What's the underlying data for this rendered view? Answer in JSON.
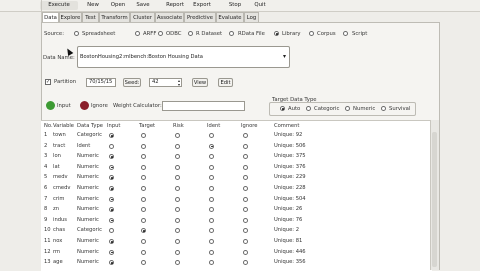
{
  "toolbar": {
    "items": [
      "Execute",
      "New",
      "Open",
      "Save",
      "Report",
      "Export",
      "Stop",
      "Quit"
    ]
  },
  "tabs": [
    "Data",
    "Explore",
    "Test",
    "Transform",
    "Cluster",
    "Associate",
    "Predictive",
    "Evaluate",
    "Log"
  ],
  "source": {
    "label": "Source:",
    "options": [
      "Spreadsheet",
      "ARFF",
      "ODBC",
      "R Dataset",
      "RData File",
      "Library",
      "Corpus",
      "Script"
    ],
    "selected": "Library"
  },
  "dataname": {
    "label": "Data Name:",
    "value": "BostonHousing2:mlbench:Boston Housing Data"
  },
  "partition": {
    "label": "Partition",
    "checked": true,
    "value": "70/15/15",
    "seed_label": "Seed:",
    "seed_value": "42",
    "view_label": "View",
    "edit_label": "Edit"
  },
  "inputs": {
    "input_label": "Input",
    "ignore_label": "Ignore",
    "weight_label": "Weight Calculator:",
    "weight_value": ""
  },
  "target_type": {
    "title": "Target Data Type",
    "options": [
      "Auto",
      "Categoric",
      "Numeric",
      "Survival"
    ],
    "selected": "Auto"
  },
  "table": {
    "headers": [
      "No.",
      "Variable",
      "Data Type",
      "Input",
      "Target",
      "Risk",
      "Ident",
      "Ignore",
      "Comment"
    ],
    "rows": [
      {
        "no": "1",
        "variable": "town",
        "type": "Categoric",
        "role": "input",
        "comment": "Unique: 92"
      },
      {
        "no": "2",
        "variable": "tract",
        "type": "Ident",
        "role": "ident",
        "comment": "Unique: 506"
      },
      {
        "no": "3",
        "variable": "lon",
        "type": "Numeric",
        "role": "input",
        "comment": "Unique: 375"
      },
      {
        "no": "4",
        "variable": "lat",
        "type": "Numeric",
        "role": "input",
        "comment": "Unique: 376"
      },
      {
        "no": "5",
        "variable": "medv",
        "type": "Numeric",
        "role": "input",
        "comment": "Unique: 229"
      },
      {
        "no": "6",
        "variable": "cmedv",
        "type": "Numeric",
        "role": "input",
        "comment": "Unique: 228"
      },
      {
        "no": "7",
        "variable": "crim",
        "type": "Numeric",
        "role": "input",
        "comment": "Unique: 504"
      },
      {
        "no": "8",
        "variable": "zn",
        "type": "Numeric",
        "role": "input",
        "comment": "Unique: 26"
      },
      {
        "no": "9",
        "variable": "indus",
        "type": "Numeric",
        "role": "input",
        "comment": "Unique: 76"
      },
      {
        "no": "10",
        "variable": "chas",
        "type": "Categoric",
        "role": "target",
        "comment": "Unique: 2"
      },
      {
        "no": "11",
        "variable": "nox",
        "type": "Numeric",
        "role": "input",
        "comment": "Unique: 81"
      },
      {
        "no": "12",
        "variable": "rm",
        "type": "Numeric",
        "role": "input",
        "comment": "Unique: 446"
      },
      {
        "no": "13",
        "variable": "age",
        "type": "Numeric",
        "role": "input",
        "comment": "Unique: 356"
      }
    ]
  },
  "colors": {
    "input_dot": "#3d9b34",
    "ignore_dot": "#8a1f2a"
  }
}
